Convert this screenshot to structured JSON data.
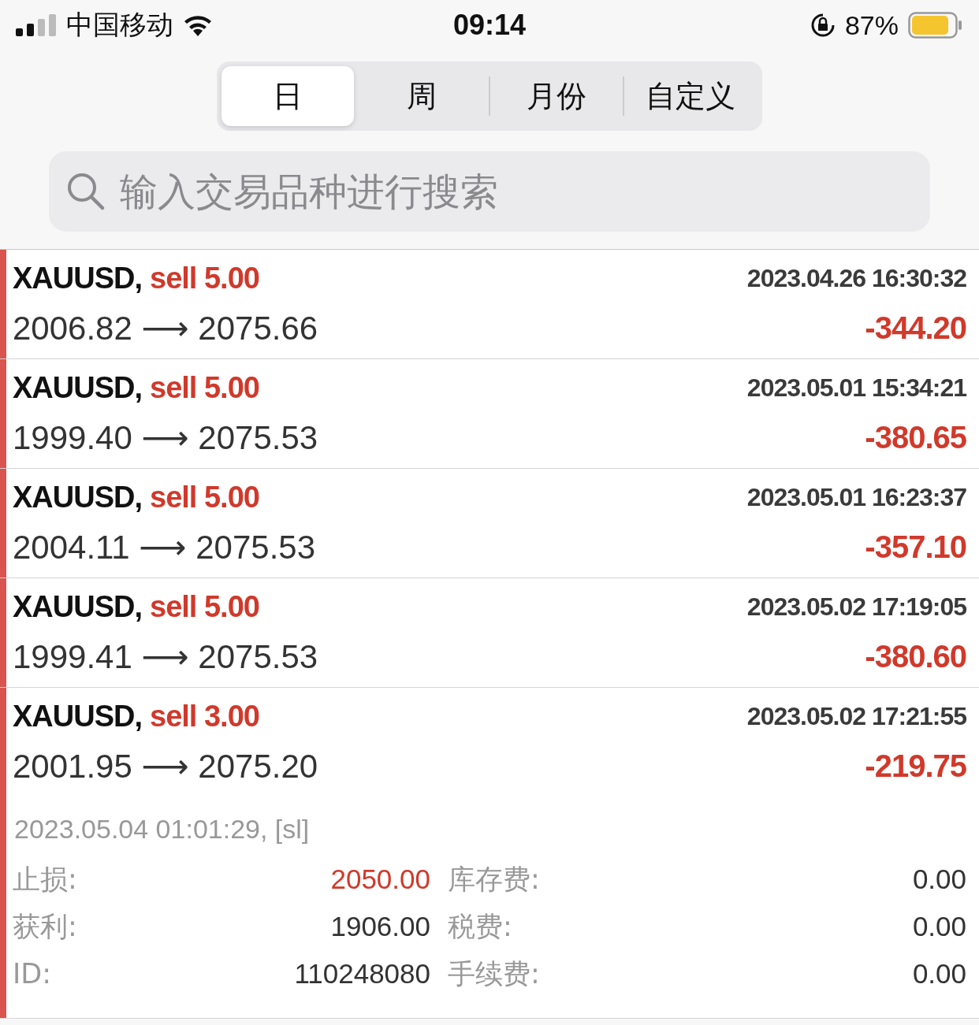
{
  "status_bar": {
    "carrier": "中国移动",
    "time": "09:14",
    "battery": "87%"
  },
  "tabs": [
    {
      "label": "日",
      "selected": true
    },
    {
      "label": "周",
      "selected": false
    },
    {
      "label": "月份",
      "selected": false
    },
    {
      "label": "自定义",
      "selected": false
    }
  ],
  "search": {
    "placeholder": "输入交易品种进行搜索"
  },
  "trades": [
    {
      "symbol": "XAUUSD,",
      "order": "sell 5.00",
      "prices": "2006.82 ⟶ 2075.66",
      "time": "2023.04.26 16:30:32",
      "profit": "-344.20",
      "expanded": false
    },
    {
      "symbol": "XAUUSD,",
      "order": "sell 5.00",
      "prices": "1999.40 ⟶ 2075.53",
      "time": "2023.05.01 15:34:21",
      "profit": "-380.65",
      "expanded": false
    },
    {
      "symbol": "XAUUSD,",
      "order": "sell 5.00",
      "prices": "2004.11 ⟶ 2075.53",
      "time": "2023.05.01 16:23:37",
      "profit": "-357.10",
      "expanded": false
    },
    {
      "symbol": "XAUUSD,",
      "order": "sell 5.00",
      "prices": "1999.41 ⟶ 2075.53",
      "time": "2023.05.02 17:19:05",
      "profit": "-380.60",
      "expanded": false
    },
    {
      "symbol": "XAUUSD,",
      "order": "sell 3.00",
      "prices": "2001.95 ⟶ 2075.20",
      "time": "2023.05.02 17:21:55",
      "profit": "-219.75",
      "expanded": true,
      "close_info": "2023.05.04 01:01:29, [sl]",
      "details": [
        {
          "label": "止损:",
          "value": "2050.00",
          "highlight": true,
          "label_2": "库存费:",
          "value_2": "0.00"
        },
        {
          "label": "获利:",
          "value": "1906.00",
          "highlight": false,
          "label_2": "税费:",
          "value_2": "0.00"
        },
        {
          "label": "ID:",
          "value": "110248080",
          "highlight": false,
          "label_2": "手续费:",
          "value_2": "0.00"
        }
      ]
    }
  ]
}
